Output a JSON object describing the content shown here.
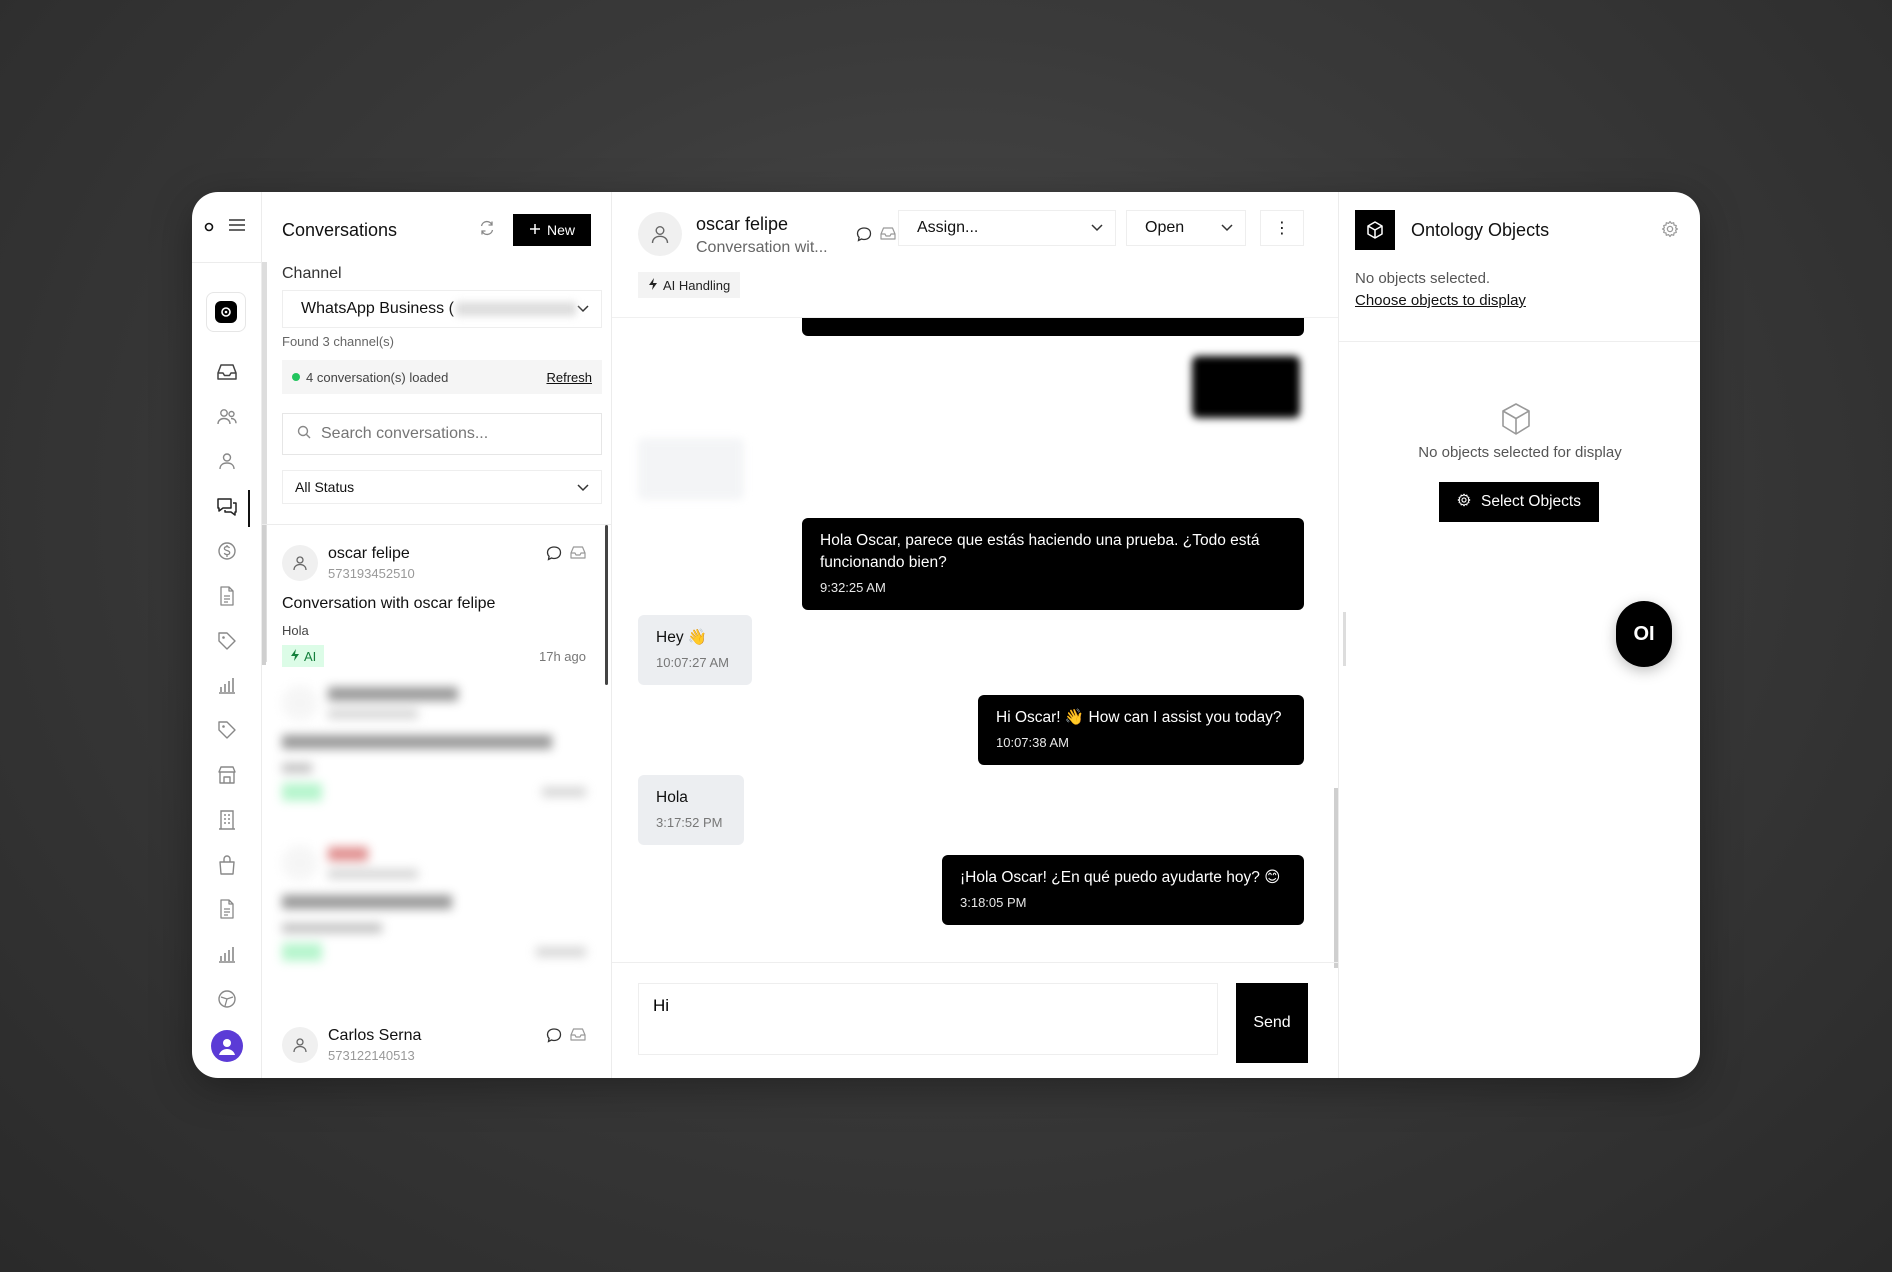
{
  "conversations_panel": {
    "title": "Conversations",
    "new_label": "New",
    "channel_label": "Channel",
    "channel_value": "WhatsApp Business (",
    "found_text": "Found 3 channel(s)",
    "loaded_text": "4 conversation(s) loaded",
    "refresh_label": "Refresh",
    "search_placeholder": "Search conversations...",
    "status_value": "All Status",
    "items": [
      {
        "name": "oscar felipe",
        "phone": "573193452510",
        "subject": "Conversation with oscar felipe",
        "preview": "Hola",
        "badge": "AI",
        "time": "17h ago"
      },
      {
        "name": "Carlos Serna",
        "phone": "573122140513"
      }
    ]
  },
  "chat": {
    "contact_name": "oscar felipe",
    "subtitle": "Conversation wit...",
    "assign_label": "Assign...",
    "status_label": "Open",
    "more_label": "⋮",
    "ai_handling_label": "AI Handling",
    "messages": [
      {
        "direction": "out",
        "text": "Hola Oscar, parece que estás haciendo una prueba. ¿Todo está funcionando bien?",
        "time": "9:32:25 AM"
      },
      {
        "direction": "in",
        "text": "Hey 👋",
        "time": "10:07:27 AM"
      },
      {
        "direction": "out",
        "text": "Hi Oscar! 👋 How can I assist you today?",
        "time": "10:07:38 AM"
      },
      {
        "direction": "in",
        "text": "Hola",
        "time": "3:17:52 PM"
      },
      {
        "direction": "out",
        "text": "¡Hola Oscar! ¿En qué puedo ayudarte hoy? 😊",
        "time": "3:18:05 PM"
      }
    ],
    "composer_value": "Hi",
    "send_label": "Send"
  },
  "ontology": {
    "title": "Ontology Objects",
    "none_selected": "No objects selected.",
    "choose_link": "Choose objects to display",
    "empty_text": "No objects selected for display",
    "select_button": "Select Objects"
  },
  "fab_label": "OI",
  "colors": {
    "accent": "#000000",
    "ai_badge_bg": "#dcfce7",
    "ai_badge_text": "#15803d",
    "status_dot": "#22c55e",
    "avatar": "#5b3bd6"
  },
  "icons": {
    "sidebar": [
      "inbox-icon",
      "users-icon",
      "user-icon",
      "chat-icon",
      "dollar-icon",
      "document-icon",
      "tag-icon",
      "bar-chart-icon",
      "tag-icon",
      "store-icon",
      "building-icon",
      "bag-icon",
      "document-icon",
      "bar-chart-icon",
      "settings-circle-icon"
    ]
  }
}
